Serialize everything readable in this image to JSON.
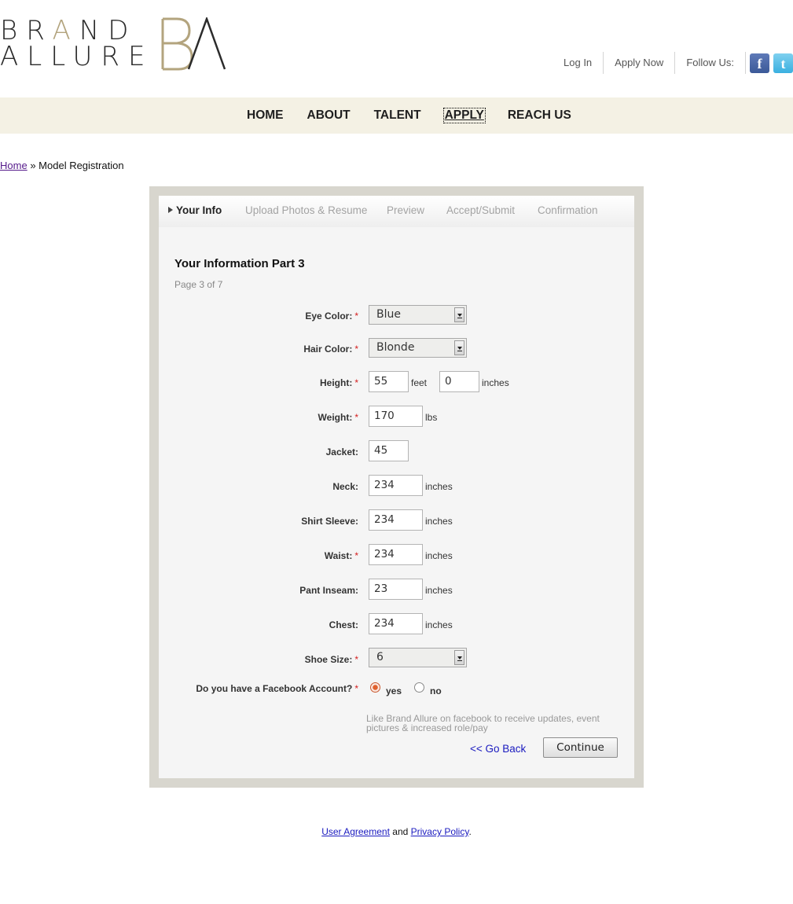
{
  "logo": {
    "line1_a": "BR",
    "line1_b": "A",
    "line1_c": "ND",
    "line2_a": "ALLURE",
    "alt": "Brand Allure"
  },
  "top_links": {
    "login": "Log In",
    "apply_now": "Apply Now",
    "follow_us": "Follow Us:"
  },
  "social": {
    "facebook_icon": "f",
    "twitter_icon": "t"
  },
  "nav": {
    "home": "HOME",
    "about": "ABOUT",
    "talent": "TALENT",
    "apply": "APPLY",
    "reach_us": "REACH US"
  },
  "breadcrumb": {
    "home": "Home",
    "separator": "»",
    "current": "Model Registration"
  },
  "steps": {
    "your_info": "Your Info",
    "upload": "Upload Photos & Resume",
    "preview": "Preview",
    "accept": "Accept/Submit",
    "confirmation": "Confirmation"
  },
  "form": {
    "title": "Your Information Part 3",
    "subtitle": "Page 3 of 7",
    "required_mark": "*",
    "eye_color": {
      "label": "Eye Color:",
      "value": "Blue"
    },
    "hair_color": {
      "label": "Hair Color:",
      "value": "Blonde"
    },
    "height": {
      "label": "Height:",
      "feet": "55",
      "feet_unit": "feet",
      "inches": "0",
      "inches_unit": "inches"
    },
    "weight": {
      "label": "Weight:",
      "value": "170",
      "unit": "lbs"
    },
    "jacket": {
      "label": "Jacket:",
      "value": "45"
    },
    "neck": {
      "label": "Neck:",
      "value": "234",
      "unit": "inches"
    },
    "shirt_sleeve": {
      "label": "Shirt Sleeve:",
      "value": "234",
      "unit": "inches"
    },
    "waist": {
      "label": "Waist:",
      "value": "234",
      "unit": "inches"
    },
    "pant_inseam": {
      "label": "Pant Inseam:",
      "value": "23",
      "unit": "inches"
    },
    "chest": {
      "label": "Chest:",
      "value": "234",
      "unit": "inches"
    },
    "shoe_size": {
      "label": "Shoe Size:",
      "value": "6"
    },
    "facebook": {
      "label": "Do you have a Facebook Account?",
      "yes": "yes",
      "no": "no",
      "selected": "yes"
    },
    "hint": "Like Brand Allure on facebook to receive updates, event pictures & increased role/pay",
    "go_back": "<< Go Back",
    "continue": "Continue"
  },
  "footer": {
    "user_agreement": "User Agreement",
    "and": "and",
    "privacy_policy": "Privacy Policy",
    "period": "."
  },
  "colors": {
    "nav_bg": "#f4f1e4",
    "gold": "#b3a47e",
    "required": "#d42020",
    "link": "#1a1abf",
    "box_border": "#d8d6ce"
  }
}
